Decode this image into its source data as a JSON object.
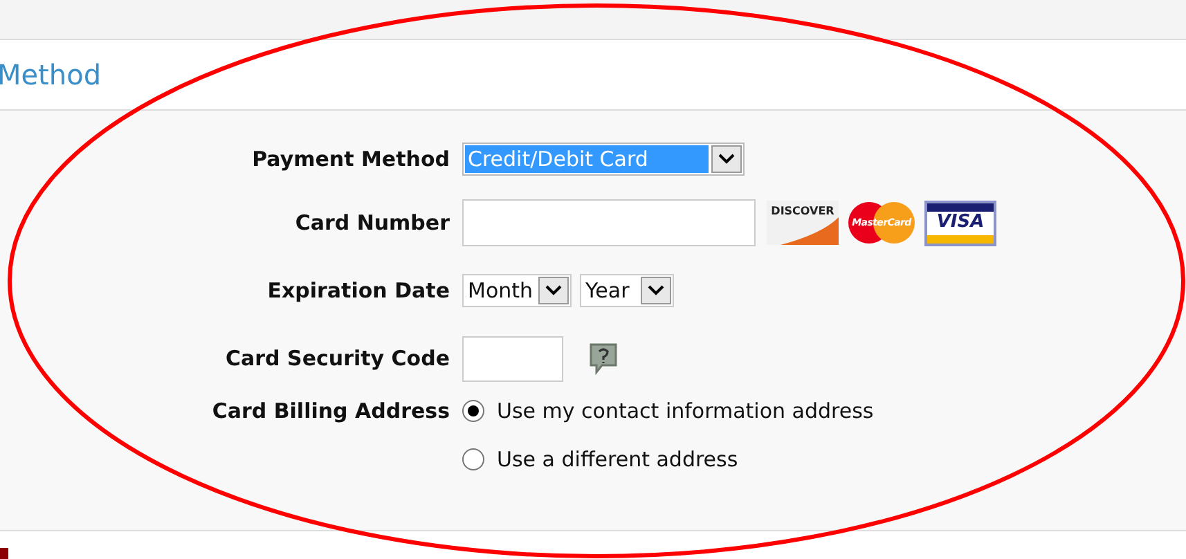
{
  "section": {
    "title": "Method"
  },
  "form": {
    "fields": [
      {
        "kind": "select",
        "label": "Payment Method",
        "value": "Credit/Debit Card",
        "highlighted": true
      },
      {
        "kind": "card",
        "label": "Card Number",
        "logos": [
          {
            "kind": "discover",
            "text": "DISCOVER"
          },
          {
            "kind": "mastercard",
            "text": "MasterCard"
          },
          {
            "kind": "visa",
            "text": "VISA"
          }
        ]
      },
      {
        "kind": "expiry",
        "label": "Expiration Date",
        "selects": [
          {
            "value": "Month"
          },
          {
            "value": "Year"
          }
        ]
      },
      {
        "kind": "code",
        "label": "Card Security Code",
        "help": true
      },
      {
        "kind": "radios",
        "label": "Card Billing Address",
        "options": [
          {
            "label": "Use my contact information address",
            "selected": true
          },
          {
            "label": "Use a different address",
            "selected": false
          }
        ]
      }
    ]
  },
  "annotation": {
    "kind": "ellipse",
    "color": "#ff0000"
  }
}
